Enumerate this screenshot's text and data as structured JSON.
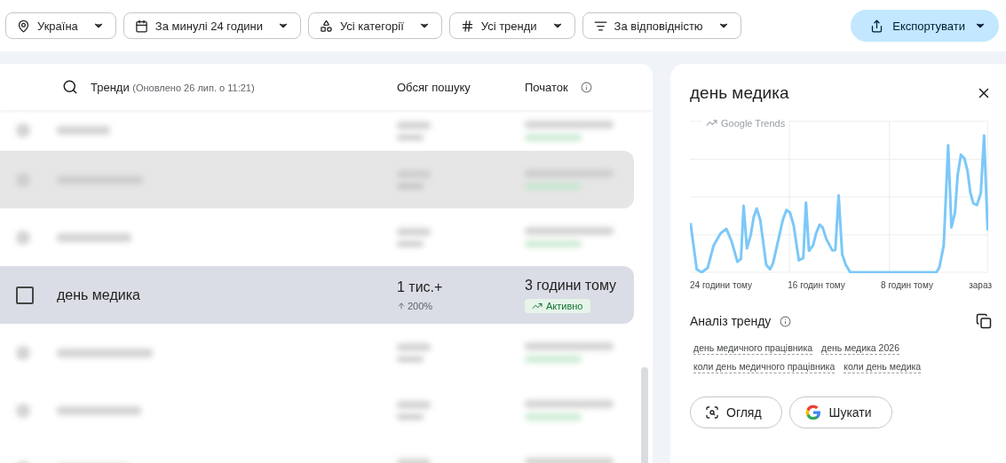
{
  "filters": [
    {
      "kind": "location",
      "label": "Україна"
    },
    {
      "kind": "calendar",
      "label": "За минулі 24 години"
    },
    {
      "kind": "category",
      "label": "Усі категорії"
    },
    {
      "kind": "hash",
      "label": "Усі тренди"
    },
    {
      "kind": "sort",
      "label": "За відповідністю"
    }
  ],
  "export_button": {
    "label": "Експортувати"
  },
  "table": {
    "title": "Тренди",
    "updated": "(Оновлено 26 лип. о 11:21)",
    "columns": [
      "Обсяг пошуку",
      "Початок"
    ],
    "rows": [
      {
        "kind": "blurred",
        "selected": false,
        "hovered": false
      },
      {
        "kind": "blurred",
        "selected": false,
        "hovered": true
      },
      {
        "kind": "blurred",
        "selected": false,
        "hovered": false
      },
      {
        "kind": "trend",
        "selected": true,
        "hovered": false,
        "checked": false,
        "name": "день медика",
        "volume": "1 тис.+",
        "change": "200%",
        "started": "3 години тому",
        "status": "Активно"
      },
      {
        "kind": "blurred",
        "selected": false,
        "hovered": false
      },
      {
        "kind": "blurred",
        "selected": false,
        "hovered": false
      },
      {
        "kind": "blurred",
        "selected": false,
        "hovered": false
      }
    ]
  },
  "detail": {
    "title": "день медика",
    "chart_brand": "Google Trends",
    "x_labels": [
      "24 години тому",
      "16 годин тому",
      "8 годин тому",
      "зараз"
    ],
    "analysis_title": "Аналіз тренду",
    "related": [
      "день медичного працівника",
      "день медика 2026",
      "коли день медичного працівника",
      "коли день медика"
    ],
    "buttons": [
      {
        "kind": "overview",
        "label": "Огляд"
      },
      {
        "kind": "google",
        "label": "Шукати"
      }
    ]
  }
}
